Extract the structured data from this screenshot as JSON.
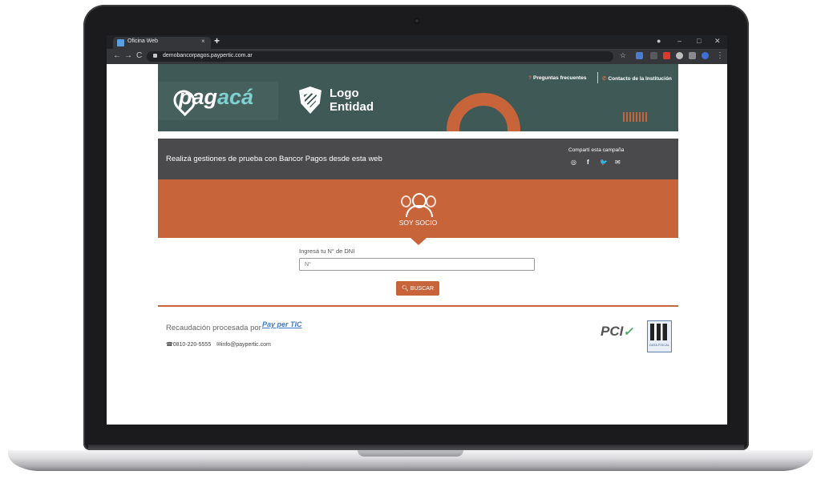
{
  "browser": {
    "tab_title": "Oficina Web",
    "tab_close": "×",
    "new_tab": "+",
    "url": "demobancorpagos.paypertic.com.ar",
    "window_controls": [
      "–",
      "□",
      "✕"
    ],
    "nav": [
      "←",
      "→",
      "C"
    ]
  },
  "header": {
    "brand_prefix": "pag",
    "brand_suffix": "acá",
    "logo_line1": "Logo",
    "logo_line2": "Entidad",
    "faq_label": "Preguntas frecuentes",
    "contact_label": "Contacto de la Institución",
    "colors": {
      "header_bg": "#3f5a56",
      "accent": "#c8643a",
      "brand_accent": "#7fd0cf"
    }
  },
  "promo": {
    "text": "Realizá gestiones de prueba con Bancor Pagos desde esta web",
    "share_label": "Compartí esta campaña",
    "share_icons": [
      "whatsapp-icon",
      "facebook-icon",
      "twitter-icon",
      "email-icon"
    ]
  },
  "socio": {
    "label": "SOY SOCIO",
    "icon": "users-icon"
  },
  "search": {
    "label": "Ingresá tu N° de DNI",
    "placeholder": "N°",
    "button_label": "BUSCAR",
    "button_icon": "search-icon"
  },
  "footer": {
    "processed_by": "Recaudación procesada por",
    "ppt_logo": "Pay per TIC",
    "phone": "0810-220-5555",
    "email": "info@paypertic.com",
    "pci_label": "PCI",
    "datafiscal_label": "DATA FISCAL"
  }
}
